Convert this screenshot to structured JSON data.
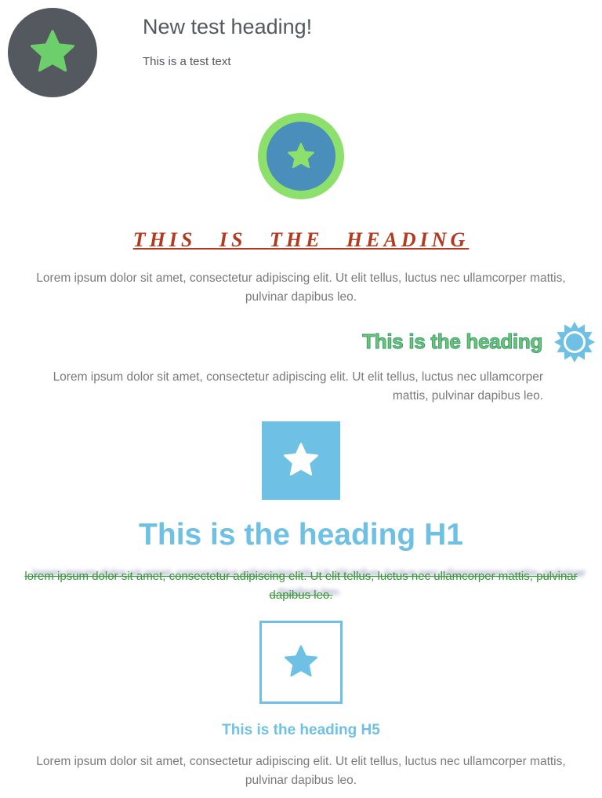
{
  "colors": {
    "dark_gray": "#54595f",
    "green": "#6ccf6c",
    "light_green": "#8ce06b",
    "steel_blue": "#4a8ebb",
    "sky_blue": "#6ec1e4",
    "rust": "#b33a1f",
    "text_gray": "#7a7a7a"
  },
  "top_box": {
    "icon": "star-icon",
    "heading": "New test heading!",
    "text": "This is a test text"
  },
  "section_serif": {
    "icon": "star-icon",
    "heading": "THIS IS THE HEADING",
    "text": "Lorem ipsum dolor sit amet, consectetur adipiscing elit. Ut elit tellus, luctus nec ullamcorper mattis, pulvinar dapibus leo."
  },
  "section_outline": {
    "icon": "sun-icon",
    "heading": "This is the heading",
    "text": "Lorem ipsum dolor sit amet, consectetur adipiscing elit. Ut elit tellus, luctus nec ullamcorper mattis, pulvinar dapibus leo."
  },
  "section_h1": {
    "icon": "star-icon",
    "heading": "This is the heading H1",
    "text": "lorem ipsum dolor sit amet, consectetur adipiscing elit. Ut elit tellus, luctus nec ullamcorper mattis, pulvinar dapibus leo."
  },
  "section_h5": {
    "icon": "star-icon",
    "heading": "This is the heading H5",
    "text": "Lorem ipsum dolor sit amet, consectetur adipiscing elit. Ut elit tellus, luctus nec ullamcorper mattis, pulvinar dapibus leo."
  }
}
